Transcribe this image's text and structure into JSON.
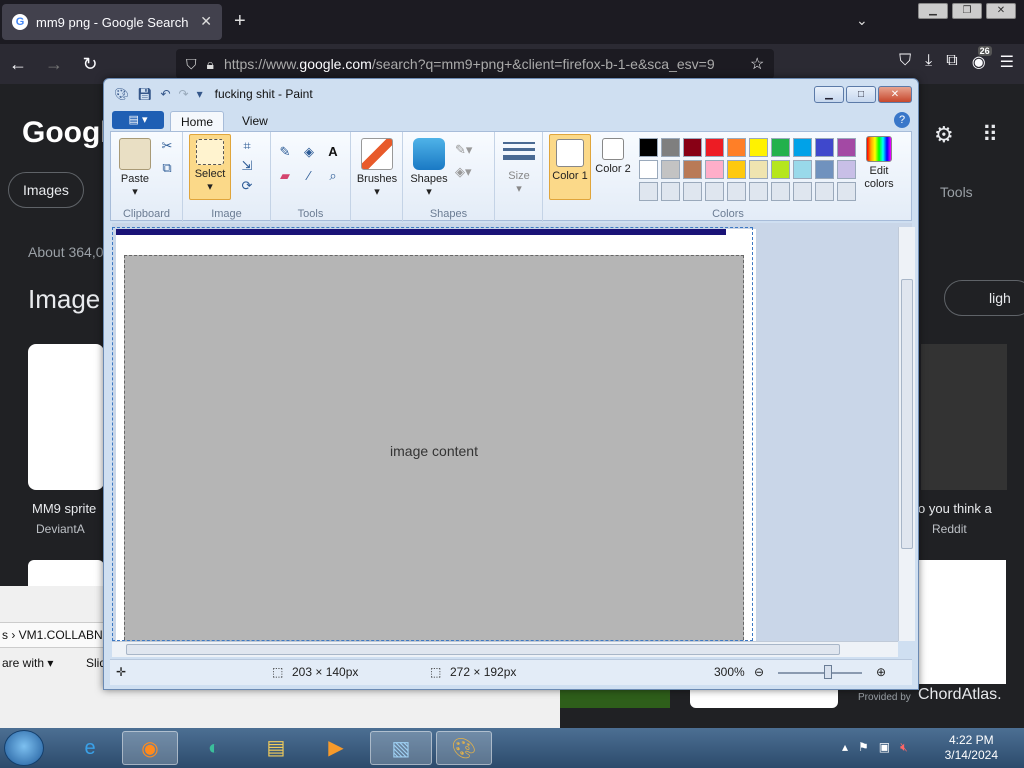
{
  "browser": {
    "tab_title": "mm9 png - Google Search",
    "url_prefix": "https://www.",
    "url_host": "google.com",
    "url_rest": "/search?q=mm9+png+&client=firefox-b-1-e&sca_esv=9",
    "ext_badge": "26"
  },
  "google": {
    "logo": "Googl",
    "chip_images": "Images",
    "about": "About 364,0",
    "images_heading": "Image",
    "tools": "Tools",
    "light_chip": "ligh",
    "cap_left": "MM9 sprite",
    "src_left": "DeviantA",
    "cap_right": "o you think a",
    "src_right": "Reddit",
    "chord": "ChordAtlas.",
    "provided": "Provided by"
  },
  "bgwindow": {
    "path": "s › VM1.COLLABN",
    "share": "are with ▾",
    "slide": "Slid"
  },
  "paint": {
    "title": "fucking shit - Paint",
    "tabs": [
      "Home",
      "View"
    ],
    "groups": {
      "clipboard": "Clipboard",
      "image": "Image",
      "tools": "Tools",
      "shapes": "Shapes",
      "colors": "Colors"
    },
    "buttons": {
      "paste": "Paste",
      "select": "Select",
      "brushes": "Brushes",
      "shapes": "Shapes",
      "size": "Size",
      "color1": "Color 1",
      "color2": "Color 2",
      "edit_colors": "Edit colors"
    },
    "palette_row1": [
      "#000000",
      "#7f7f7f",
      "#880015",
      "#ed1c24",
      "#ff7f27",
      "#fff200",
      "#22b14c",
      "#00a2e8",
      "#3f48cc",
      "#a349a4"
    ],
    "palette_row2": [
      "#ffffff",
      "#c3c3c3",
      "#b97a57",
      "#ffaec9",
      "#ffc90e",
      "#efe4b0",
      "#b5e61d",
      "#99d9ea",
      "#7092be",
      "#c8bfe7"
    ],
    "status": {
      "selection_size": "203 × 140px",
      "image_size": "272 × 192px",
      "zoom": "300%"
    },
    "canvas_placeholder": "image content"
  },
  "taskbar": {
    "time": "4:22 PM",
    "date": "3/14/2024"
  }
}
